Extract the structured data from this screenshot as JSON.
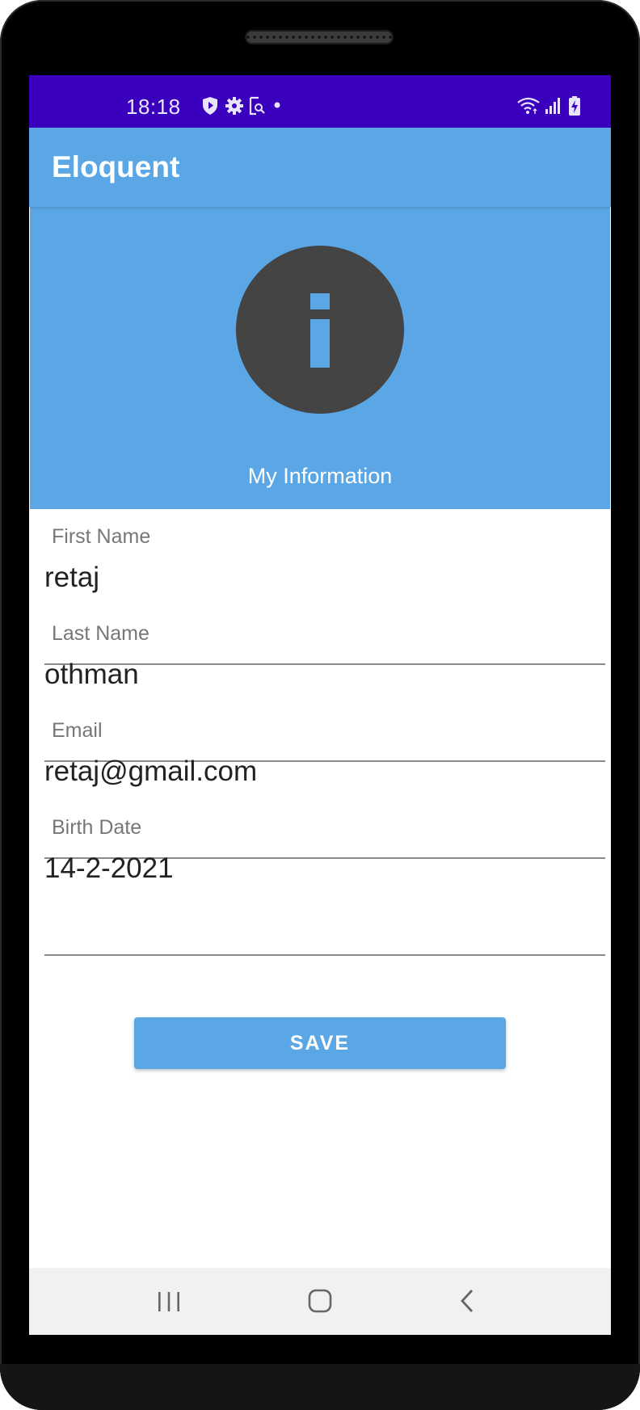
{
  "status_bar": {
    "time": "18:18",
    "left_icons": [
      "shield-play-icon",
      "gear-icon",
      "screenshot-icon",
      "dot-icon"
    ],
    "right_icons": [
      "wifi-icon",
      "signal-icon",
      "battery-charging-icon"
    ]
  },
  "app_bar": {
    "title": "Eloquent"
  },
  "header": {
    "icon": "info-icon",
    "label": "My Information"
  },
  "form": {
    "first_name": {
      "label": "First Name",
      "value": "retaj"
    },
    "last_name": {
      "label": "Last Name",
      "value": "othman"
    },
    "email": {
      "label": "Email",
      "value": "retaj@gmail.com"
    },
    "birth_date": {
      "label": "Birth Date",
      "value": "14-2-2021"
    }
  },
  "save_button": {
    "label": "SAVE"
  },
  "nav_bar": {
    "icons": [
      "recents-icon",
      "home-icon",
      "back-icon"
    ]
  },
  "colors": {
    "status_bar": "#3a00bd",
    "app_bar": "#5ba7e6",
    "accent": "#5ba7e6",
    "info_icon": "#444444",
    "nav_bar": "#f1f1f1"
  }
}
